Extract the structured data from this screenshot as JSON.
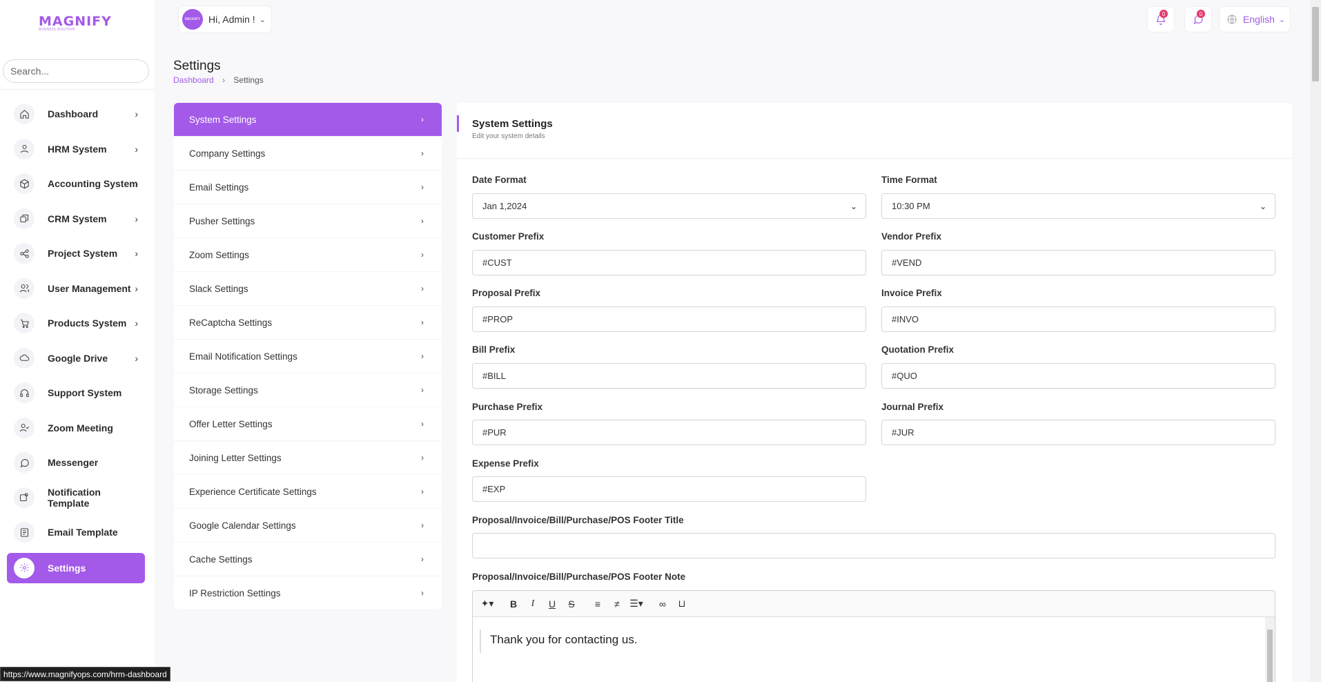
{
  "app": {
    "logo": "MAGNIFY",
    "logo_tagline": "BUSINESS SOLUTION"
  },
  "sidebar": {
    "search_placeholder": "Search...",
    "items": [
      {
        "label": "Dashboard",
        "icon": "home-icon",
        "has_chevron": true
      },
      {
        "label": "HRM System",
        "icon": "user-icon",
        "has_chevron": true
      },
      {
        "label": "Accounting System",
        "icon": "box-icon",
        "has_chevron": true
      },
      {
        "label": "CRM System",
        "icon": "layers-icon",
        "has_chevron": true
      },
      {
        "label": "Project System",
        "icon": "share-icon",
        "has_chevron": true
      },
      {
        "label": "User Management",
        "icon": "users-icon",
        "has_chevron": true
      },
      {
        "label": "Products System",
        "icon": "cart-icon",
        "has_chevron": true
      },
      {
        "label": "Google Drive",
        "icon": "cloud-icon",
        "has_chevron": true
      },
      {
        "label": "Support System",
        "icon": "headset-icon",
        "has_chevron": false
      },
      {
        "label": "Zoom Meeting",
        "icon": "user-check-icon",
        "has_chevron": false
      },
      {
        "label": "Messenger",
        "icon": "message-icon",
        "has_chevron": false
      },
      {
        "label": "Notification Template",
        "icon": "notification-icon",
        "has_chevron": false
      },
      {
        "label": "Email Template",
        "icon": "template-icon",
        "has_chevron": false
      },
      {
        "label": "Settings",
        "icon": "gear-icon",
        "has_chevron": false,
        "active": true
      }
    ]
  },
  "header": {
    "greeting": "Hi, Admin !",
    "avatar_text": "MAGNIFY",
    "notifications_count": "0",
    "messages_count": "0",
    "language": "English"
  },
  "page": {
    "title": "Settings",
    "breadcrumb": [
      "Dashboard",
      "Settings"
    ]
  },
  "settings_menu": [
    "System Settings",
    "Company Settings",
    "Email Settings",
    "Pusher Settings",
    "Zoom Settings",
    "Slack Settings",
    "ReCaptcha Settings",
    "Email Notification Settings",
    "Storage Settings",
    "Offer Letter Settings",
    "Joining Letter Settings",
    "Experience Certificate Settings",
    "Google Calendar Settings",
    "Cache Settings",
    "IP Restriction Settings"
  ],
  "panel": {
    "title": "System Settings",
    "subtitle": "Edit your system details",
    "fields": {
      "date_format": {
        "label": "Date Format",
        "value": "Jan 1,2024"
      },
      "time_format": {
        "label": "Time Format",
        "value": "10:30 PM"
      },
      "customer_prefix": {
        "label": "Customer Prefix",
        "value": "#CUST"
      },
      "vendor_prefix": {
        "label": "Vendor Prefix",
        "value": "#VEND"
      },
      "proposal_prefix": {
        "label": "Proposal Prefix",
        "value": "#PROP"
      },
      "invoice_prefix": {
        "label": "Invoice Prefix",
        "value": "#INVO"
      },
      "bill_prefix": {
        "label": "Bill Prefix",
        "value": "#BILL"
      },
      "quotation_prefix": {
        "label": "Quotation Prefix",
        "value": "#QUO"
      },
      "purchase_prefix": {
        "label": "Purchase Prefix",
        "value": "#PUR"
      },
      "journal_prefix": {
        "label": "Journal Prefix",
        "value": "#JUR"
      },
      "expense_prefix": {
        "label": "Expense Prefix",
        "value": "#EXP"
      },
      "footer_title": {
        "label": "Proposal/Invoice/Bill/Purchase/POS Footer Title",
        "value": ""
      },
      "footer_note": {
        "label": "Proposal/Invoice/Bill/Purchase/POS Footer Note",
        "value": "Thank you for contacting us."
      }
    }
  },
  "status_bar": {
    "url": "https://www.magnifyops.com/hrm-dashboard"
  },
  "colors": {
    "accent": "#a35ae8",
    "badge": "#e23b6d"
  }
}
